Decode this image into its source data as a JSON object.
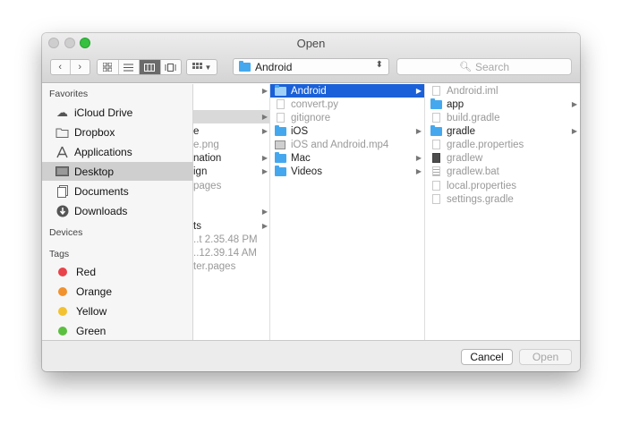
{
  "window": {
    "title": "Open"
  },
  "toolbar": {
    "back_icon": "chevron-left",
    "forward_icon": "chevron-right",
    "view_modes": [
      "icon-view",
      "list-view",
      "column-view",
      "cover-flow-view"
    ],
    "active_view": "column-view",
    "arrange_icon": "grid",
    "location": "Android",
    "search_placeholder": "Search"
  },
  "sidebar": {
    "favorites_header": "Favorites",
    "favorites": [
      {
        "label": "iCloud Drive",
        "icon": "cloud-icon"
      },
      {
        "label": "Dropbox",
        "icon": "folder-icon"
      },
      {
        "label": "Applications",
        "icon": "applications-icon"
      },
      {
        "label": "Desktop",
        "icon": "desktop-icon",
        "selected": true
      },
      {
        "label": "Documents",
        "icon": "documents-icon"
      },
      {
        "label": "Downloads",
        "icon": "downloads-icon"
      }
    ],
    "devices_header": "Devices",
    "tags_header": "Tags",
    "tags": [
      {
        "label": "Red",
        "color": "#e8434a"
      },
      {
        "label": "Orange",
        "color": "#f0922e"
      },
      {
        "label": "Yellow",
        "color": "#f3c232"
      },
      {
        "label": "Green",
        "color": "#5bbf3f"
      }
    ]
  },
  "column1": {
    "rows": [
      {
        "text": "",
        "arrow": true
      },
      {
        "text": "",
        "arrow": true,
        "highlight": true
      },
      {
        "text": "e",
        "arrow": true
      },
      {
        "text": "e.png",
        "dim": true
      },
      {
        "text": "nation",
        "arrow": true
      },
      {
        "text": "ign",
        "arrow": true
      },
      {
        "text": "pages",
        "dim": true
      },
      {
        "text": "",
        "arrow": true
      },
      {
        "text": "ts",
        "arrow": true
      },
      {
        "text": "..t 2.35.48 PM",
        "dim": true
      },
      {
        "text": "..12.39.14 AM",
        "dim": true
      },
      {
        "text": "ter.pages",
        "dim": true
      }
    ]
  },
  "column2": {
    "rows": [
      {
        "text": "Android",
        "type": "folder",
        "arrow": true,
        "selected": true
      },
      {
        "text": "convert.py",
        "type": "file",
        "dim": true
      },
      {
        "text": "gitignore",
        "type": "file",
        "dim": true
      },
      {
        "text": "iOS",
        "type": "folder",
        "arrow": true
      },
      {
        "text": "iOS and Android.mp4",
        "type": "media",
        "dim": true
      },
      {
        "text": "Mac",
        "type": "folder",
        "arrow": true
      },
      {
        "text": "Videos",
        "type": "folder",
        "arrow": true
      }
    ]
  },
  "column3": {
    "rows": [
      {
        "text": "Android.iml",
        "type": "file",
        "dim": true
      },
      {
        "text": "app",
        "type": "folder",
        "arrow": true
      },
      {
        "text": "build.gradle",
        "type": "file",
        "dim": true
      },
      {
        "text": "gradle",
        "type": "folder",
        "arrow": true
      },
      {
        "text": "gradle.properties",
        "type": "file",
        "dim": true
      },
      {
        "text": "gradlew",
        "type": "exec",
        "dim": true
      },
      {
        "text": "gradlew.bat",
        "type": "grid",
        "dim": true
      },
      {
        "text": "local.properties",
        "type": "file",
        "dim": true
      },
      {
        "text": "settings.gradle",
        "type": "file",
        "dim": true
      }
    ]
  },
  "buttons": {
    "cancel": "Cancel",
    "open": "Open"
  }
}
